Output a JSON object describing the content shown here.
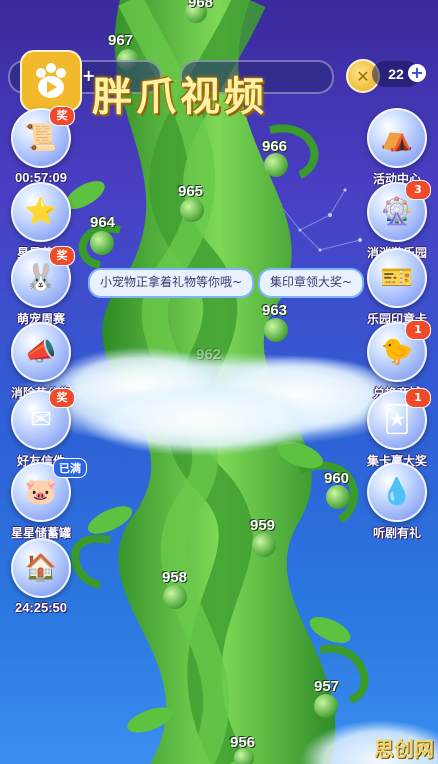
{
  "header": {
    "title": "胖爪视频",
    "coin_count": "22",
    "coin_plus": "+",
    "left_plus": "+"
  },
  "colors": {
    "sky_top": "#3a2a9c",
    "sky_bottom": "#3b8ef0",
    "vine_green": "#4fb33a",
    "badge_red": "#f04a2a"
  },
  "left_menu": [
    {
      "label": "00:57:09",
      "icon": "certificate-icon",
      "badge": "奖",
      "is_timer": true
    },
    {
      "label": "星星花房",
      "icon": "star-flower-icon",
      "badge": ""
    },
    {
      "label": "萌宠周赛",
      "icon": "bunny-pet-icon",
      "badge": "奖"
    },
    {
      "label": "消除节公告",
      "icon": "megaphone-icon",
      "badge": ""
    },
    {
      "label": "好友信件",
      "icon": "envelope-icon",
      "badge": "奖"
    },
    {
      "label": "星星储蓄罐",
      "icon": "piggy-bank-icon",
      "tag": "已满"
    },
    {
      "label": "24:25:50",
      "icon": "special-shop-icon",
      "is_timer": true
    }
  ],
  "right_menu": [
    {
      "label": "活动中心",
      "icon": "tent-icon",
      "badge": ""
    },
    {
      "label": "消消游乐园",
      "icon": "ferris-wheel-icon",
      "badge": "3"
    },
    {
      "label": "乐园印章卡",
      "icon": "stamp-card-icon",
      "badge": ""
    },
    {
      "label": "兑换商城",
      "icon": "chick-shop-icon",
      "badge": "1"
    },
    {
      "label": "集卡赢大奖",
      "icon": "card-pack-icon",
      "badge": "1"
    },
    {
      "label": "听剧有礼",
      "icon": "blue-creature-icon",
      "badge": ""
    }
  ],
  "speech": {
    "left": "小宠物正拿着礼物等你哦~",
    "right": "集印章领大奖~"
  },
  "levels": [
    "968",
    "967",
    "966",
    "965",
    "964",
    "963",
    "962",
    "960",
    "959",
    "958",
    "957",
    "956"
  ],
  "watermark": "思创网"
}
